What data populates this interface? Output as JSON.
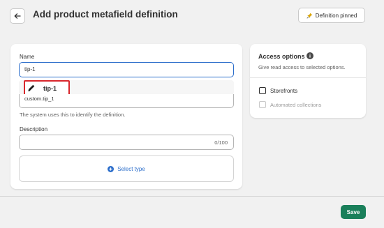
{
  "header": {
    "title": "Add product metafield definition",
    "pin_label": "Definition pinned"
  },
  "form": {
    "name_label": "Name",
    "name_value": "tip-1",
    "suggestion": "tip-1",
    "namespace_key": "custom.tip_1",
    "help_text": "The system uses this to identify the definition.",
    "description_label": "Description",
    "description_counter": "0/100",
    "select_type_label": "Select type"
  },
  "access": {
    "title": "Access options",
    "subtitle": "Give read access to selected options.",
    "options": [
      "Storefronts",
      "Automated collections"
    ]
  },
  "footer": {
    "save_label": "Save"
  },
  "colors": {
    "accent": "#2c6ecb",
    "save": "#1a7f5a",
    "highlight": "#d8262b"
  }
}
